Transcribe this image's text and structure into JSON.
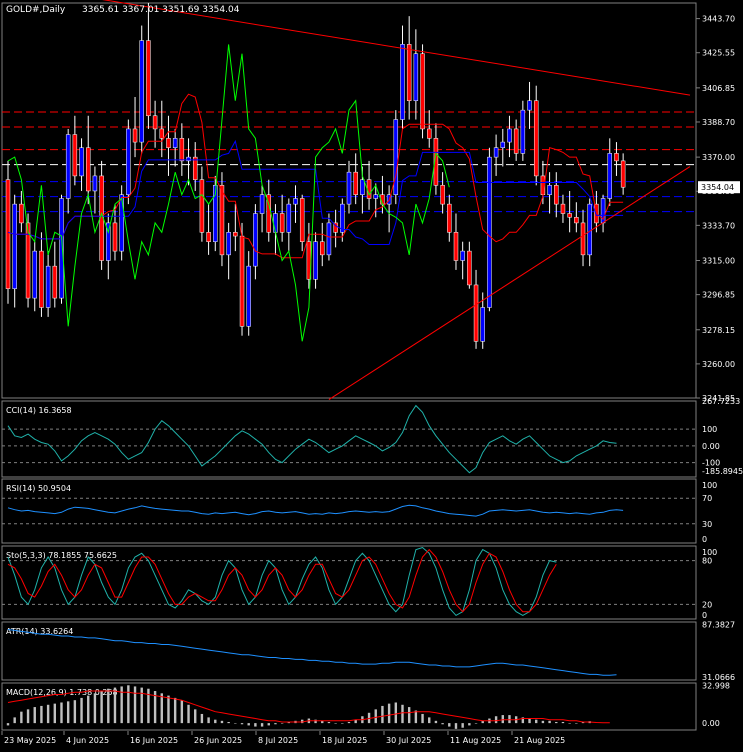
{
  "main": {
    "symbol": "GOLD#,Daily",
    "ohlc": "3365.61 3367.01 3351.69 3354.04",
    "last_price": "3354.04",
    "axis_labels": [
      "3443.70",
      "3425.55",
      "3406.85",
      "3388.70",
      "3370.00",
      "3351.85",
      "3333.70",
      "3315.00",
      "3296.85",
      "3278.15",
      "3260.00",
      "3241.85"
    ],
    "axis_values": [
      3443.7,
      3425.55,
      3406.85,
      3388.7,
      3370.0,
      3351.85,
      3333.7,
      3315.0,
      3296.85,
      3278.15,
      3260.0,
      3241.85
    ]
  },
  "panels": [
    {
      "key": "cci",
      "label": "CCI(14) 16.3658",
      "axis_labels": [
        "267.7233",
        "100",
        "0.00",
        "-100",
        "-185.8945"
      ]
    },
    {
      "key": "rsi",
      "label": "RSI(14) 50.9504",
      "axis_labels": [
        "100",
        "70",
        "30",
        "0"
      ]
    },
    {
      "key": "sto",
      "label": "Sto(5,3,3) 78.1855 75.6625",
      "axis_labels": [
        "100",
        "80",
        "20",
        "0"
      ]
    },
    {
      "key": "atr",
      "label": "ATR(14) 33.6264",
      "axis_labels": [
        "87.3827",
        "31.0666"
      ]
    },
    {
      "key": "macd",
      "label": "MACD(12,26,9) 1.738 0.258",
      "axis_labels": [
        "32.998",
        "0.00"
      ]
    }
  ],
  "x_axis": {
    "labels": [
      "23 May 2025",
      "4 Jun 2025",
      "16 Jun 2025",
      "26 Jun 2025",
      "8 Jul 2025",
      "18 Jul 2025",
      "30 Jul 2025",
      "11 Aug 2025",
      "21 Aug 2025"
    ]
  },
  "colors": {
    "background": "#000000",
    "grid": "#808080",
    "bull_candle": "#0000ff",
    "bear_candle": "#ff0000",
    "candle_wick": "#ffffff",
    "cci": "#20b2aa",
    "rsi": "#1e90ff",
    "sto_main": "#20b2aa",
    "sto_signal": "#ff0000",
    "atr": "#1e90ff",
    "macd_hist": "#c0c0c0",
    "macd_signal": "#ff0000",
    "trendline": "#ff0000",
    "kijun": "#0000ff",
    "tenkan": "#ff0000",
    "chikou": "#00ff00"
  },
  "chart_data": {
    "type": "candlestick",
    "ylim": [
      3241.85,
      3452.0
    ],
    "candles": [
      {
        "o": 3358,
        "h": 3368,
        "l": 3292,
        "c": 3300
      },
      {
        "o": 3300,
        "h": 3350,
        "l": 3290,
        "c": 3345
      },
      {
        "o": 3345,
        "h": 3352,
        "l": 3330,
        "c": 3335
      },
      {
        "o": 3335,
        "h": 3340,
        "l": 3290,
        "c": 3295
      },
      {
        "o": 3295,
        "h": 3325,
        "l": 3288,
        "c": 3320
      },
      {
        "o": 3320,
        "h": 3330,
        "l": 3285,
        "c": 3290
      },
      {
        "o": 3290,
        "h": 3320,
        "l": 3285,
        "c": 3312
      },
      {
        "o": 3312,
        "h": 3325,
        "l": 3290,
        "c": 3295
      },
      {
        "o": 3295,
        "h": 3350,
        "l": 3292,
        "c": 3348
      },
      {
        "o": 3348,
        "h": 3385,
        "l": 3340,
        "c": 3382
      },
      {
        "o": 3382,
        "h": 3392,
        "l": 3355,
        "c": 3360
      },
      {
        "o": 3360,
        "h": 3380,
        "l": 3352,
        "c": 3375
      },
      {
        "o": 3375,
        "h": 3392,
        "l": 3345,
        "c": 3352
      },
      {
        "o": 3352,
        "h": 3365,
        "l": 3340,
        "c": 3360
      },
      {
        "o": 3360,
        "h": 3368,
        "l": 3310,
        "c": 3315
      },
      {
        "o": 3315,
        "h": 3340,
        "l": 3305,
        "c": 3335
      },
      {
        "o": 3335,
        "h": 3345,
        "l": 3315,
        "c": 3320
      },
      {
        "o": 3320,
        "h": 3355,
        "l": 3315,
        "c": 3350
      },
      {
        "o": 3350,
        "h": 3390,
        "l": 3345,
        "c": 3385
      },
      {
        "o": 3385,
        "h": 3402,
        "l": 3370,
        "c": 3378
      },
      {
        "o": 3378,
        "h": 3440,
        "l": 3372,
        "c": 3432
      },
      {
        "o": 3432,
        "h": 3452,
        "l": 3385,
        "c": 3392
      },
      {
        "o": 3392,
        "h": 3400,
        "l": 3375,
        "c": 3385
      },
      {
        "o": 3385,
        "h": 3400,
        "l": 3370,
        "c": 3380
      },
      {
        "o": 3380,
        "h": 3392,
        "l": 3360,
        "c": 3375
      },
      {
        "o": 3375,
        "h": 3385,
        "l": 3365,
        "c": 3380
      },
      {
        "o": 3380,
        "h": 3388,
        "l": 3360,
        "c": 3368
      },
      {
        "o": 3368,
        "h": 3380,
        "l": 3355,
        "c": 3370
      },
      {
        "o": 3370,
        "h": 3378,
        "l": 3352,
        "c": 3358
      },
      {
        "o": 3358,
        "h": 3365,
        "l": 3325,
        "c": 3330
      },
      {
        "o": 3330,
        "h": 3345,
        "l": 3318,
        "c": 3325
      },
      {
        "o": 3325,
        "h": 3360,
        "l": 3320,
        "c": 3355
      },
      {
        "o": 3355,
        "h": 3362,
        "l": 3312,
        "c": 3318
      },
      {
        "o": 3318,
        "h": 3335,
        "l": 3305,
        "c": 3330
      },
      {
        "o": 3330,
        "h": 3345,
        "l": 3320,
        "c": 3328
      },
      {
        "o": 3328,
        "h": 3335,
        "l": 3275,
        "c": 3280
      },
      {
        "o": 3280,
        "h": 3320,
        "l": 3275,
        "c": 3312
      },
      {
        "o": 3312,
        "h": 3345,
        "l": 3305,
        "c": 3340
      },
      {
        "o": 3340,
        "h": 3355,
        "l": 3330,
        "c": 3350
      },
      {
        "o": 3350,
        "h": 3358,
        "l": 3325,
        "c": 3330
      },
      {
        "o": 3330,
        "h": 3345,
        "l": 3318,
        "c": 3340
      },
      {
        "o": 3340,
        "h": 3350,
        "l": 3325,
        "c": 3330
      },
      {
        "o": 3330,
        "h": 3348,
        "l": 3320,
        "c": 3345
      },
      {
        "o": 3345,
        "h": 3355,
        "l": 3335,
        "c": 3348
      },
      {
        "o": 3348,
        "h": 3350,
        "l": 3320,
        "c": 3325
      },
      {
        "o": 3325,
        "h": 3335,
        "l": 3300,
        "c": 3305
      },
      {
        "o": 3305,
        "h": 3330,
        "l": 3300,
        "c": 3325
      },
      {
        "o": 3325,
        "h": 3335,
        "l": 3312,
        "c": 3318
      },
      {
        "o": 3318,
        "h": 3340,
        "l": 3315,
        "c": 3335
      },
      {
        "o": 3335,
        "h": 3342,
        "l": 3322,
        "c": 3330
      },
      {
        "o": 3330,
        "h": 3348,
        "l": 3325,
        "c": 3345
      },
      {
        "o": 3345,
        "h": 3368,
        "l": 3340,
        "c": 3362
      },
      {
        "o": 3362,
        "h": 3372,
        "l": 3345,
        "c": 3350
      },
      {
        "o": 3350,
        "h": 3365,
        "l": 3340,
        "c": 3358
      },
      {
        "o": 3358,
        "h": 3368,
        "l": 3342,
        "c": 3348
      },
      {
        "o": 3348,
        "h": 3356,
        "l": 3338,
        "c": 3350
      },
      {
        "o": 3350,
        "h": 3360,
        "l": 3340,
        "c": 3345
      },
      {
        "o": 3345,
        "h": 3355,
        "l": 3330,
        "c": 3350
      },
      {
        "o": 3350,
        "h": 3395,
        "l": 3345,
        "c": 3390
      },
      {
        "o": 3390,
        "h": 3440,
        "l": 3385,
        "c": 3430
      },
      {
        "o": 3430,
        "h": 3445,
        "l": 3390,
        "c": 3400
      },
      {
        "o": 3400,
        "h": 3438,
        "l": 3390,
        "c": 3425
      },
      {
        "o": 3425,
        "h": 3430,
        "l": 3380,
        "c": 3385
      },
      {
        "o": 3385,
        "h": 3395,
        "l": 3375,
        "c": 3380
      },
      {
        "o": 3380,
        "h": 3388,
        "l": 3350,
        "c": 3355
      },
      {
        "o": 3355,
        "h": 3362,
        "l": 3340,
        "c": 3345
      },
      {
        "o": 3345,
        "h": 3350,
        "l": 3325,
        "c": 3330
      },
      {
        "o": 3330,
        "h": 3340,
        "l": 3310,
        "c": 3315
      },
      {
        "o": 3315,
        "h": 3325,
        "l": 3305,
        "c": 3320
      },
      {
        "o": 3320,
        "h": 3325,
        "l": 3300,
        "c": 3302
      },
      {
        "o": 3302,
        "h": 3310,
        "l": 3268,
        "c": 3272
      },
      {
        "o": 3272,
        "h": 3298,
        "l": 3268,
        "c": 3290
      },
      {
        "o": 3290,
        "h": 3375,
        "l": 3288,
        "c": 3370
      },
      {
        "o": 3370,
        "h": 3382,
        "l": 3360,
        "c": 3375
      },
      {
        "o": 3375,
        "h": 3385,
        "l": 3365,
        "c": 3378
      },
      {
        "o": 3378,
        "h": 3392,
        "l": 3370,
        "c": 3385
      },
      {
        "o": 3385,
        "h": 3390,
        "l": 3368,
        "c": 3372
      },
      {
        "o": 3372,
        "h": 3400,
        "l": 3368,
        "c": 3395
      },
      {
        "o": 3395,
        "h": 3410,
        "l": 3385,
        "c": 3400
      },
      {
        "o": 3400,
        "h": 3408,
        "l": 3355,
        "c": 3360
      },
      {
        "o": 3360,
        "h": 3368,
        "l": 3345,
        "c": 3350
      },
      {
        "o": 3350,
        "h": 3362,
        "l": 3340,
        "c": 3355
      },
      {
        "o": 3355,
        "h": 3362,
        "l": 3338,
        "c": 3345
      },
      {
        "o": 3345,
        "h": 3350,
        "l": 3335,
        "c": 3340
      },
      {
        "o": 3340,
        "h": 3352,
        "l": 3330,
        "c": 3338
      },
      {
        "o": 3338,
        "h": 3346,
        "l": 3330,
        "c": 3335
      },
      {
        "o": 3335,
        "h": 3342,
        "l": 3312,
        "c": 3318
      },
      {
        "o": 3318,
        "h": 3348,
        "l": 3312,
        "c": 3345
      },
      {
        "o": 3345,
        "h": 3352,
        "l": 3330,
        "c": 3335
      },
      {
        "o": 3335,
        "h": 3350,
        "l": 3330,
        "c": 3348
      },
      {
        "o": 3348,
        "h": 3380,
        "l": 3344,
        "c": 3372
      },
      {
        "o": 3372,
        "h": 3378,
        "l": 3360,
        "c": 3368
      },
      {
        "o": 3368,
        "h": 3372,
        "l": 3350,
        "c": 3354
      }
    ],
    "horizontal_levels": [
      {
        "value": 3394,
        "color": "#ff0000",
        "style": "dashed"
      },
      {
        "value": 3386,
        "color": "#ff0000",
        "style": "dashed"
      },
      {
        "value": 3374,
        "color": "#ff0000",
        "style": "dashed"
      },
      {
        "value": 3366,
        "color": "#ffffff",
        "style": "dashed"
      },
      {
        "value": 3357,
        "color": "#0000ff",
        "style": "dashed"
      },
      {
        "value": 3349,
        "color": "#0000ff",
        "style": "dashed"
      },
      {
        "value": 3341,
        "color": "#0000ff",
        "style": "dashed"
      }
    ],
    "trendlines": [
      {
        "from": [
          0,
          3462
        ],
        "to": [
          105,
          3403
        ]
      },
      {
        "from": [
          48,
          3241
        ],
        "to": [
          107,
          3365
        ]
      }
    ],
    "cci": [
      120,
      60,
      50,
      70,
      40,
      20,
      10,
      -30,
      -90,
      -60,
      -20,
      30,
      60,
      80,
      60,
      40,
      10,
      -40,
      -80,
      -60,
      -40,
      20,
      100,
      150,
      120,
      80,
      40,
      0,
      -60,
      -120,
      -90,
      -60,
      -20,
      20,
      60,
      90,
      70,
      40,
      10,
      -40,
      -80,
      -100,
      -60,
      -20,
      10,
      40,
      20,
      -10,
      -40,
      -20,
      0,
      30,
      60,
      40,
      20,
      0,
      -30,
      -10,
      20,
      80,
      180,
      240,
      200,
      120,
      60,
      10,
      -40,
      -80,
      -120,
      -160,
      -130,
      -40,
      20,
      40,
      60,
      30,
      10,
      40,
      60,
      20,
      -20,
      -60,
      -80,
      -100,
      -90,
      -60,
      -40,
      -20,
      0,
      30,
      20,
      16
    ],
    "rsi": [
      55,
      52,
      50,
      51,
      49,
      48,
      47,
      46,
      48,
      53,
      56,
      55,
      54,
      52,
      50,
      48,
      47,
      50,
      53,
      55,
      58,
      56,
      54,
      53,
      52,
      51,
      50,
      50,
      48,
      46,
      45,
      47,
      46,
      47,
      48,
      46,
      44,
      46,
      49,
      50,
      48,
      47,
      48,
      49,
      47,
      45,
      46,
      45,
      47,
      46,
      47,
      49,
      50,
      49,
      48,
      49,
      48,
      49,
      53,
      57,
      59,
      58,
      55,
      53,
      50,
      48,
      46,
      45,
      44,
      43,
      42,
      45,
      50,
      51,
      52,
      51,
      50,
      51,
      52,
      50,
      48,
      47,
      48,
      47,
      46,
      47,
      46,
      45,
      47,
      48,
      51,
      52,
      51
    ],
    "sto_k": [
      85,
      60,
      30,
      20,
      40,
      70,
      85,
      70,
      40,
      20,
      30,
      60,
      85,
      75,
      50,
      30,
      20,
      40,
      70,
      85,
      90,
      80,
      60,
      40,
      20,
      15,
      25,
      40,
      35,
      25,
      20,
      30,
      60,
      80,
      70,
      40,
      20,
      30,
      60,
      80,
      70,
      40,
      20,
      30,
      55,
      75,
      85,
      70,
      40,
      20,
      30,
      55,
      80,
      90,
      80,
      60,
      40,
      20,
      10,
      20,
      60,
      95,
      98,
      90,
      70,
      40,
      15,
      5,
      10,
      40,
      80,
      95,
      90,
      70,
      40,
      20,
      10,
      5,
      10,
      30,
      60,
      80,
      78
    ],
    "sto_d": [
      75,
      70,
      55,
      35,
      30,
      45,
      65,
      75,
      60,
      40,
      30,
      40,
      60,
      75,
      70,
      50,
      30,
      30,
      50,
      70,
      85,
      85,
      75,
      55,
      35,
      20,
      20,
      30,
      35,
      30,
      25,
      25,
      40,
      60,
      70,
      60,
      40,
      30,
      40,
      60,
      70,
      60,
      40,
      30,
      40,
      60,
      75,
      75,
      55,
      35,
      30,
      40,
      60,
      80,
      85,
      75,
      55,
      35,
      20,
      15,
      30,
      60,
      85,
      95,
      85,
      65,
      40,
      20,
      10,
      20,
      50,
      75,
      90,
      85,
      65,
      40,
      20,
      10,
      10,
      20,
      40,
      60,
      75
    ],
    "atr": [
      82,
      81,
      80,
      79,
      78,
      77,
      77,
      76,
      75,
      75,
      74,
      74,
      73,
      73,
      72,
      71,
      70,
      70,
      69,
      68,
      68,
      67,
      67,
      66,
      66,
      65,
      64,
      63,
      62,
      61,
      60,
      59,
      58,
      57,
      56,
      55,
      55,
      54,
      53,
      52,
      52,
      51,
      51,
      50,
      50,
      49,
      49,
      48,
      48,
      47,
      47,
      46,
      46,
      45,
      45,
      45,
      46,
      46,
      47,
      47,
      47,
      46,
      45,
      44,
      44,
      43,
      43,
      42,
      42,
      42,
      43,
      44,
      45,
      46,
      46,
      45,
      44,
      44,
      43,
      42,
      41,
      40,
      39,
      38,
      37,
      36,
      35,
      34,
      34,
      33,
      33,
      33.6
    ],
    "macd_hist": [
      -2,
      5,
      10,
      12,
      14,
      15,
      16,
      17,
      18,
      19,
      20,
      22,
      24,
      26,
      28,
      30,
      31,
      32,
      33,
      32,
      31,
      30,
      28,
      26,
      24,
      22,
      20,
      16,
      12,
      8,
      5,
      3,
      2,
      1,
      0,
      -1,
      -2,
      -3,
      -3,
      -2,
      -1,
      0,
      1,
      2,
      3,
      4,
      3,
      2,
      1,
      0,
      0,
      1,
      3,
      6,
      9,
      12,
      15,
      17,
      18,
      16,
      14,
      11,
      8,
      5,
      2,
      -1,
      -3,
      -5,
      -4,
      -2,
      0,
      2,
      4,
      6,
      7,
      7,
      6,
      5,
      4,
      3,
      2,
      2,
      1,
      1,
      0,
      0,
      1,
      1.7
    ],
    "macd_signal": [
      18,
      19,
      20,
      21,
      22,
      23,
      24,
      25,
      25,
      26,
      27,
      27,
      28,
      28,
      28,
      28,
      28,
      27,
      27,
      26,
      26,
      25,
      24,
      23,
      22,
      21,
      20,
      18,
      16,
      14,
      12,
      10,
      9,
      8,
      7,
      6,
      5,
      4,
      3,
      2,
      2,
      1,
      1,
      1,
      1,
      2,
      2,
      2,
      2,
      2,
      2,
      2,
      3,
      3,
      4,
      5,
      6,
      7,
      8,
      9,
      9,
      10,
      10,
      10,
      9,
      8,
      7,
      6,
      5,
      4,
      3,
      2,
      2,
      2,
      3,
      3,
      3,
      4,
      4,
      4,
      4,
      3,
      3,
      3,
      2,
      2,
      1,
      1,
      0.5,
      0.3,
      0.26
    ]
  }
}
